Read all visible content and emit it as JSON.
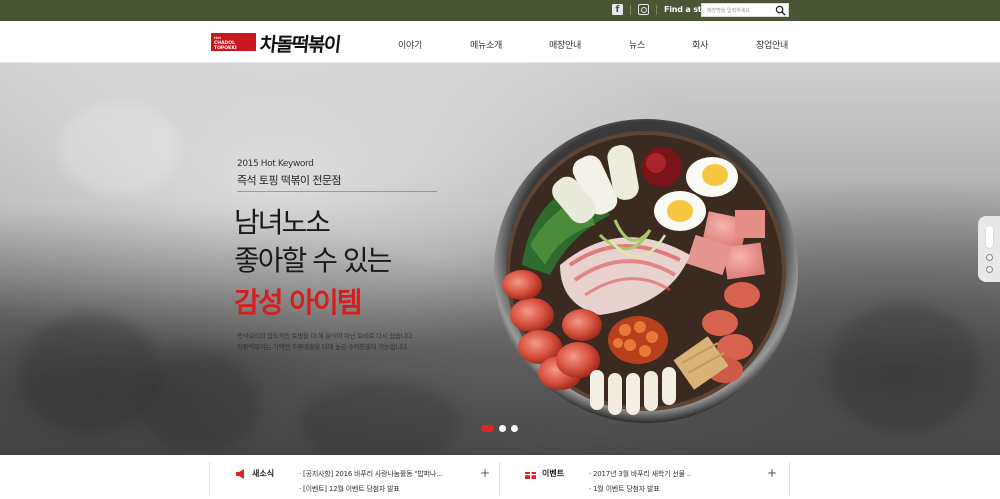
{
  "topbar": {
    "facebook_glyph": "f",
    "find_store": "Find a store",
    "search_placeholder": "매장명을 입력하세요"
  },
  "header": {
    "logo_badge_top": "Hot",
    "logo_badge_brand": "CHADOL",
    "logo_badge_brand2": "TOPOKKI",
    "logo_text": "차돌떡볶이",
    "nav": [
      "이야기",
      "메뉴소개",
      "매장안내",
      "뉴스",
      "회사",
      "창업안내"
    ]
  },
  "hero": {
    "keyword_small": "2015 Hot Keyword",
    "keyword_sub": "즉석 토핑 떡볶이 전문점",
    "headline_line1": "남녀노소",
    "headline_line2": "좋아할 수 있는",
    "headline_red": "감성 아이템",
    "desc_line1": "즉석요리와 압도적인 토핑을 더 해 분식이 아닌 요리로 다시 섰습니다.",
    "desc_line2": "차돌떡볶이는 가맥엔 주류매출을 더해 높은 수익창출이 가능합니다.",
    "slider_active_index": 1,
    "slide_count": 3
  },
  "news": {
    "category": "새소식",
    "items": [
      "· [공지사항] 2016 바푸리 사랑나눔활동 \"밥퍼나...",
      "· [이벤트] 12월 이벤트 당첨자 발표"
    ]
  },
  "events": {
    "category": "이벤트",
    "items": [
      "· 2017년 3월 바푸리 새학기 선물 ..",
      "· 1월 이벤트 당첨자 발표"
    ]
  },
  "more_label": "+",
  "colors": {
    "topbar": "#4a5533",
    "accent": "#d51f1f",
    "logo_red": "#c8171e"
  }
}
